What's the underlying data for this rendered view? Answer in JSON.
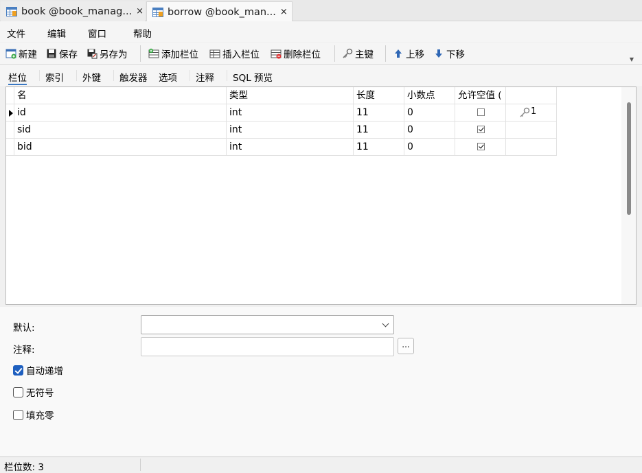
{
  "tabs": [
    {
      "label": "book @book_manag...",
      "close": "×",
      "icon": "table-icon"
    },
    {
      "label": "borrow @book_man...",
      "close": "×",
      "icon": "table-icon"
    }
  ],
  "menu": {
    "file": "文件",
    "edit": "编辑",
    "window": "窗口",
    "help": "帮助"
  },
  "toolbar": {
    "new": "新建",
    "save": "保存",
    "save_as": "另存为",
    "add_field": "添加栏位",
    "insert_field": "插入栏位",
    "delete_field": "删除栏位",
    "primary_key": "主键",
    "move_up": "上移",
    "move_down": "下移"
  },
  "subtabs": [
    "栏位",
    "索引",
    "外键",
    "触发器",
    "选项",
    "注释",
    "SQL 预览"
  ],
  "grid": {
    "headers": [
      "名",
      "类型",
      "长度",
      "小数点",
      "允许空值 ("
    ],
    "rows": [
      {
        "name": "id",
        "type": "int",
        "length": "11",
        "decimals": "0",
        "nullable": false,
        "key": "1"
      },
      {
        "name": "sid",
        "type": "int",
        "length": "11",
        "decimals": "0",
        "nullable": true,
        "key": ""
      },
      {
        "name": "bid",
        "type": "int",
        "length": "11",
        "decimals": "0",
        "nullable": true,
        "key": ""
      }
    ]
  },
  "props": {
    "default_label": "默认:",
    "comment_label": "注释:",
    "default_value": "",
    "comment_value": "",
    "dots": "...",
    "auto_increment": {
      "label": "自动递增",
      "checked": true
    },
    "unsigned": {
      "label": "无符号",
      "checked": false
    },
    "zerofill": {
      "label": "填充零",
      "checked": false
    }
  },
  "status": {
    "text": "栏位数: 3"
  },
  "colors": {
    "accent": "#1e5fbf",
    "tab_underline": "#3b78c3"
  }
}
